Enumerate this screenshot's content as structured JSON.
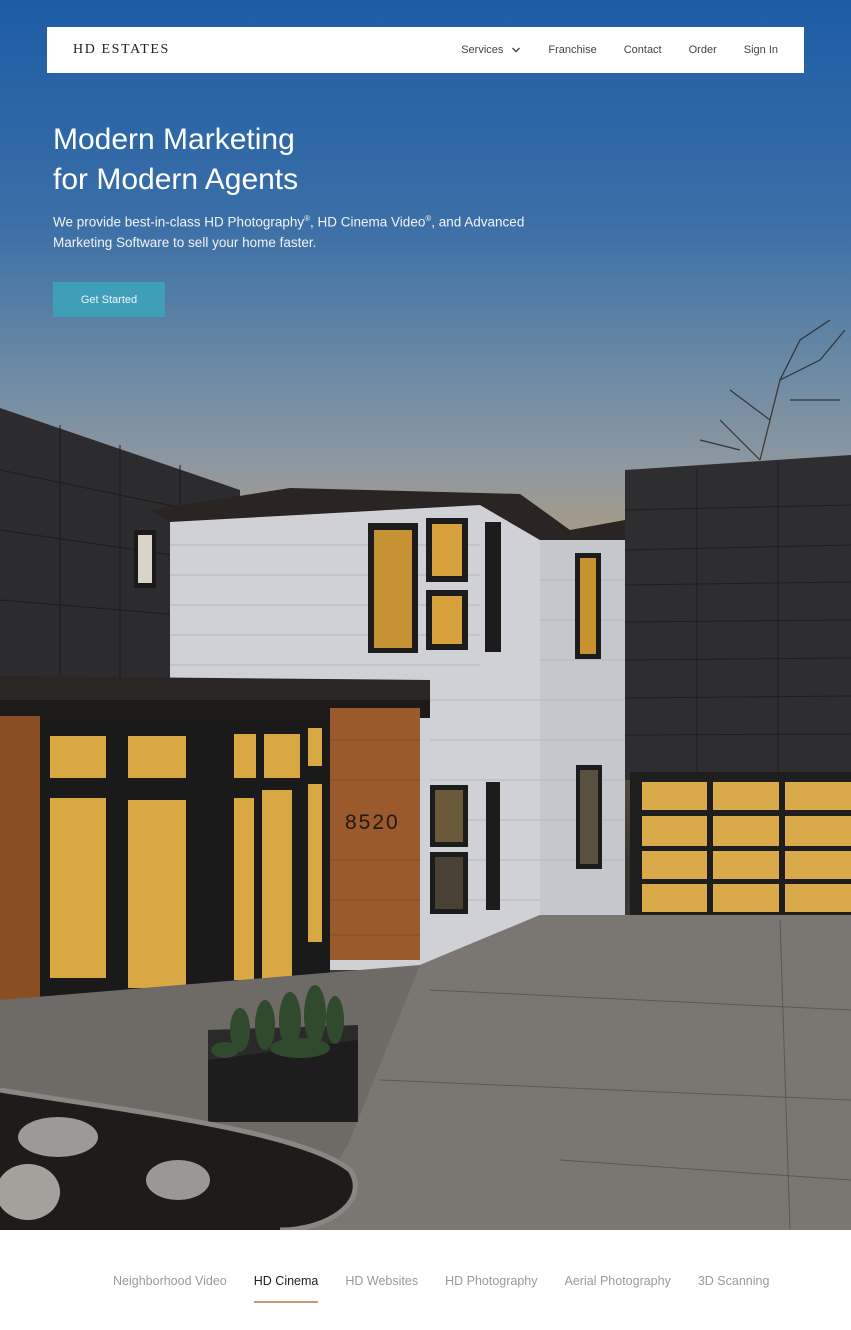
{
  "brand": {
    "logo": "HD ESTATES"
  },
  "nav": {
    "items": [
      {
        "label": "Services",
        "has_dropdown": true
      },
      {
        "label": "Franchise"
      },
      {
        "label": "Contact"
      },
      {
        "label": "Order"
      },
      {
        "label": "Sign In"
      }
    ]
  },
  "hero": {
    "title_line1": "Modern Marketing",
    "title_line2": "for Modern Agents",
    "sub_part1": "We provide best-in-class HD Photography",
    "sub_reg1": "®",
    "sub_part2": ", HD Cinema Video",
    "sub_reg2": "®",
    "sub_part3": ", and Advanced Marketing Software to sell your home faster.",
    "cta_label": "Get Started",
    "house_number": "8520"
  },
  "tabs": {
    "items": [
      {
        "label": "Neighborhood Video"
      },
      {
        "label": "HD Cinema",
        "active": true
      },
      {
        "label": "HD Websites"
      },
      {
        "label": "HD Photography"
      },
      {
        "label": "Aerial Photography"
      },
      {
        "label": "3D Scanning"
      }
    ]
  },
  "colors": {
    "accent": "#3f9fb8",
    "tab_underline": "#c49a6c",
    "sky_top": "#1d5ca6"
  }
}
